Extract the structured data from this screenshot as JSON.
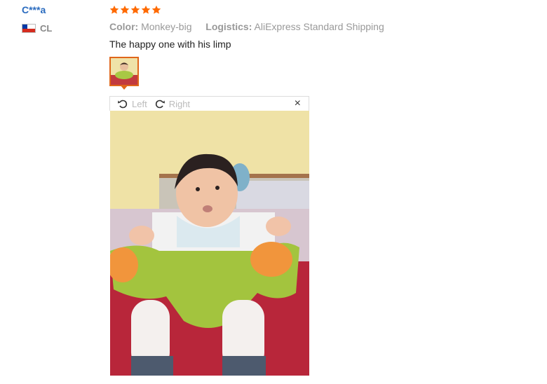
{
  "reviewer": {
    "name": "C***a",
    "country_code": "CL",
    "flag": "chile-flag"
  },
  "rating": {
    "stars": 5,
    "max": 5,
    "color": "#ff6a00"
  },
  "attributes": {
    "color_label": "Color:",
    "color_value": "Monkey-big",
    "logistics_label": "Logistics:",
    "logistics_value": "AliExpress Standard Shipping"
  },
  "review_text": "The happy one with his limp",
  "viewer": {
    "rotate_left_label": "Left",
    "rotate_right_label": "Right",
    "close_symbol": "×",
    "accent_color": "#e0661a"
  }
}
